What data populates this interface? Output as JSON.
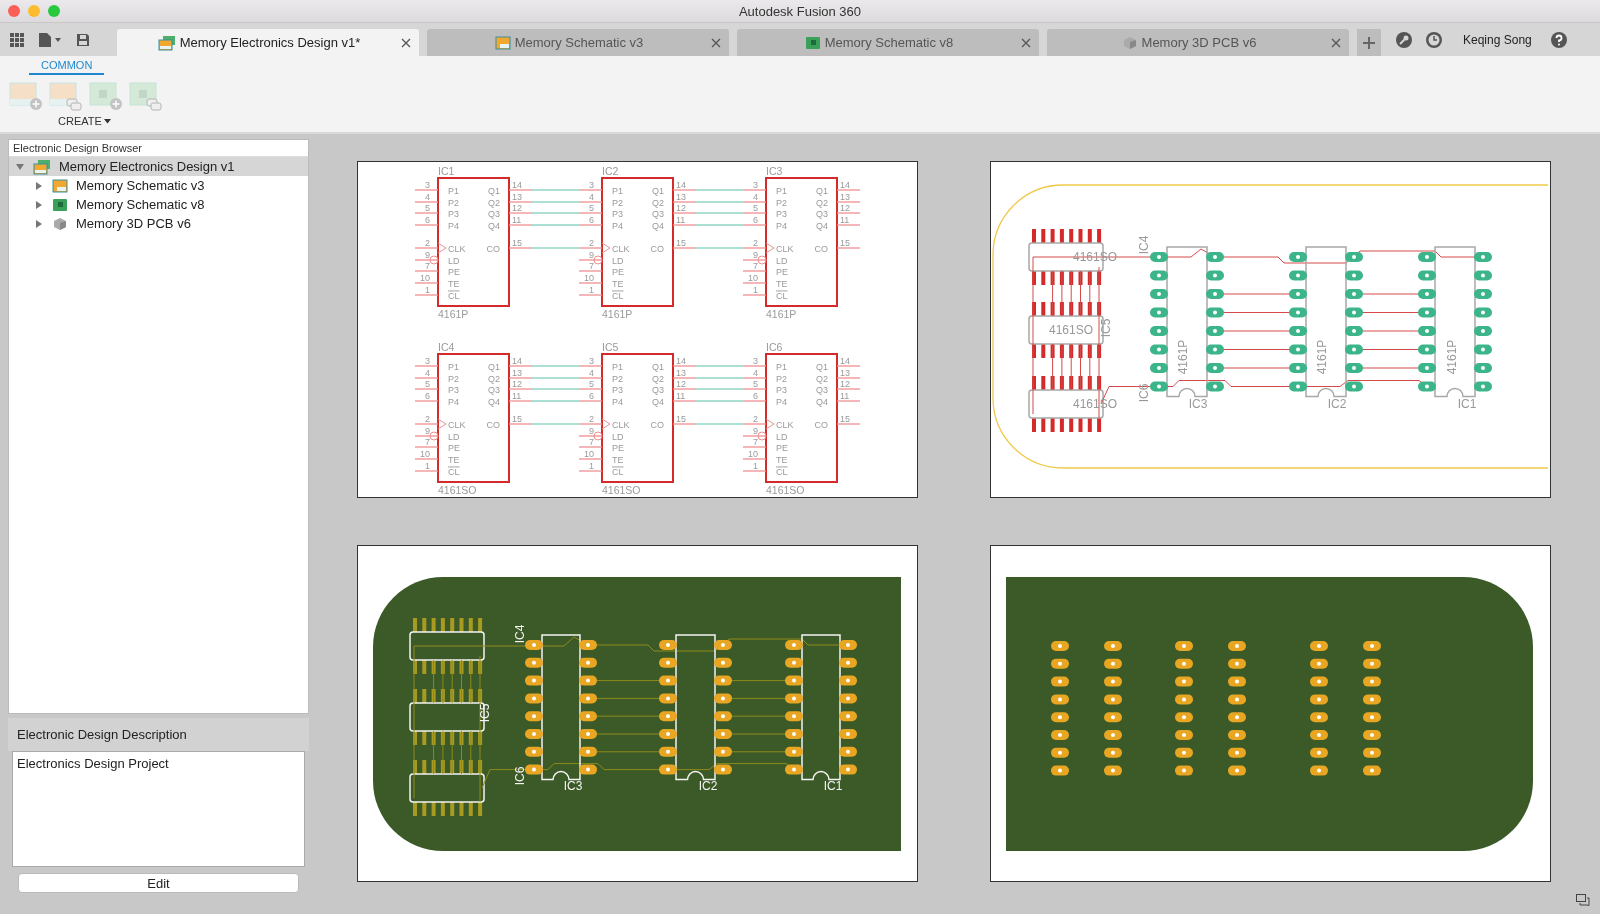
{
  "window": {
    "title": "Autodesk Fusion 360"
  },
  "tabs": [
    {
      "label": "Memory Electronics Design v1*",
      "kind": "design",
      "selected": true
    },
    {
      "label": "Memory Schematic v3",
      "kind": "schematic",
      "selected": false
    },
    {
      "label": "Memory Schematic v8",
      "kind": "board",
      "selected": false
    },
    {
      "label": "Memory 3D PCB v6",
      "kind": "pcb3d",
      "selected": false
    }
  ],
  "user": {
    "name": "Keqing Song"
  },
  "toolbar": {
    "tabs": [
      {
        "label": "COMMON",
        "selected": true
      }
    ],
    "group_label": "CREATE"
  },
  "browser": {
    "title": "Electronic Design Browser",
    "tree": [
      {
        "label": "Memory Electronics Design v1",
        "kind": "design",
        "selected": true,
        "expanded": true,
        "children": [
          {
            "label": "Memory Schematic v3",
            "kind": "schematic",
            "selected": false,
            "expanded": false
          },
          {
            "label": "Memory Schematic v8",
            "kind": "board",
            "selected": false,
            "expanded": false
          },
          {
            "label": "Memory 3D PCB v6",
            "kind": "pcb3d",
            "selected": false,
            "expanded": false
          }
        ]
      }
    ]
  },
  "description": {
    "title": "Electronic Design Description",
    "text": "Electronics Design Project",
    "button": "Edit"
  },
  "viewports": [
    {
      "kind": "schematic",
      "parts": [
        {
          "name": "IC1",
          "package": "4161P",
          "left_pins": [
            {
              "number": "3",
              "label": "P1",
              "kind": "plain"
            },
            {
              "number": "4",
              "label": "P2",
              "kind": "plain"
            },
            {
              "number": "5",
              "label": "P3",
              "kind": "plain"
            },
            {
              "number": "6",
              "label": "P4",
              "kind": "plain"
            },
            {
              "number": "2",
              "label": "CLK",
              "kind": "clock"
            },
            {
              "number": "9",
              "label": "LD",
              "kind": "inverted"
            },
            {
              "number": "7",
              "label": "PE",
              "kind": "plain"
            },
            {
              "number": "10",
              "label": "TE",
              "kind": "plain"
            },
            {
              "number": "1",
              "label": "CL",
              "kind": "active_low"
            }
          ],
          "right_pins": [
            {
              "label": "Q1",
              "number": "14"
            },
            {
              "label": "Q2",
              "number": "13"
            },
            {
              "label": "Q3",
              "number": "12"
            },
            {
              "label": "Q4",
              "number": "11"
            },
            {
              "label": "CO",
              "number": "15"
            }
          ]
        },
        {
          "name": "IC2",
          "package": "4161P",
          "left_pins": [
            {
              "number": "3",
              "label": "P1",
              "kind": "plain"
            },
            {
              "number": "4",
              "label": "P2",
              "kind": "plain"
            },
            {
              "number": "5",
              "label": "P3",
              "kind": "plain"
            },
            {
              "number": "6",
              "label": "P4",
              "kind": "plain"
            },
            {
              "number": "2",
              "label": "CLK",
              "kind": "clock"
            },
            {
              "number": "9",
              "label": "LD",
              "kind": "inverted"
            },
            {
              "number": "7",
              "label": "PE",
              "kind": "plain"
            },
            {
              "number": "10",
              "label": "TE",
              "kind": "plain"
            },
            {
              "number": "1",
              "label": "CL",
              "kind": "active_low"
            }
          ],
          "right_pins": [
            {
              "label": "Q1",
              "number": "14"
            },
            {
              "label": "Q2",
              "number": "13"
            },
            {
              "label": "Q3",
              "number": "12"
            },
            {
              "label": "Q4",
              "number": "11"
            },
            {
              "label": "CO",
              "number": "15"
            }
          ]
        },
        {
          "name": "IC3",
          "package": "4161P",
          "left_pins": [
            {
              "number": "3",
              "label": "P1",
              "kind": "plain"
            },
            {
              "number": "4",
              "label": "P2",
              "kind": "plain"
            },
            {
              "number": "5",
              "label": "P3",
              "kind": "plain"
            },
            {
              "number": "6",
              "label": "P4",
              "kind": "plain"
            },
            {
              "number": "2",
              "label": "CLK",
              "kind": "clock"
            },
            {
              "number": "9",
              "label": "LD",
              "kind": "inverted"
            },
            {
              "number": "7",
              "label": "PE",
              "kind": "plain"
            },
            {
              "number": "10",
              "label": "TE",
              "kind": "plain"
            },
            {
              "number": "1",
              "label": "CL",
              "kind": "active_low"
            }
          ],
          "right_pins": [
            {
              "label": "Q1",
              "number": "14"
            },
            {
              "label": "Q2",
              "number": "13"
            },
            {
              "label": "Q3",
              "number": "12"
            },
            {
              "label": "Q4",
              "number": "11"
            },
            {
              "label": "CO",
              "number": "15"
            }
          ]
        },
        {
          "name": "IC4",
          "package": "4161SO",
          "left_pins": [
            {
              "number": "3",
              "label": "P1",
              "kind": "plain"
            },
            {
              "number": "4",
              "label": "P2",
              "kind": "plain"
            },
            {
              "number": "5",
              "label": "P3",
              "kind": "plain"
            },
            {
              "number": "6",
              "label": "P4",
              "kind": "plain"
            },
            {
              "number": "2",
              "label": "CLK",
              "kind": "clock"
            },
            {
              "number": "9",
              "label": "LD",
              "kind": "inverted"
            },
            {
              "number": "7",
              "label": "PE",
              "kind": "plain"
            },
            {
              "number": "10",
              "label": "TE",
              "kind": "plain"
            },
            {
              "number": "1",
              "label": "CL",
              "kind": "active_low"
            }
          ],
          "right_pins": [
            {
              "label": "Q1",
              "number": "14"
            },
            {
              "label": "Q2",
              "number": "13"
            },
            {
              "label": "Q3",
              "number": "12"
            },
            {
              "label": "Q4",
              "number": "11"
            },
            {
              "label": "CO",
              "number": "15"
            }
          ]
        },
        {
          "name": "IC5",
          "package": "4161SO",
          "left_pins": [
            {
              "number": "3",
              "label": "P1",
              "kind": "plain"
            },
            {
              "number": "4",
              "label": "P2",
              "kind": "plain"
            },
            {
              "number": "5",
              "label": "P3",
              "kind": "plain"
            },
            {
              "number": "6",
              "label": "P4",
              "kind": "plain"
            },
            {
              "number": "2",
              "label": "CLK",
              "kind": "clock"
            },
            {
              "number": "9",
              "label": "LD",
              "kind": "inverted"
            },
            {
              "number": "7",
              "label": "PE",
              "kind": "plain"
            },
            {
              "number": "10",
              "label": "TE",
              "kind": "plain"
            },
            {
              "number": "1",
              "label": "CL",
              "kind": "active_low"
            }
          ],
          "right_pins": [
            {
              "label": "Q1",
              "number": "14"
            },
            {
              "label": "Q2",
              "number": "13"
            },
            {
              "label": "Q3",
              "number": "12"
            },
            {
              "label": "Q4",
              "number": "11"
            },
            {
              "label": "CO",
              "number": "15"
            }
          ]
        },
        {
          "name": "IC6",
          "package": "4161SO",
          "left_pins": [
            {
              "number": "3",
              "label": "P1",
              "kind": "plain"
            },
            {
              "number": "4",
              "label": "P2",
              "kind": "plain"
            },
            {
              "number": "5",
              "label": "P3",
              "kind": "plain"
            },
            {
              "number": "6",
              "label": "P4",
              "kind": "plain"
            },
            {
              "number": "2",
              "label": "CLK",
              "kind": "clock"
            },
            {
              "number": "9",
              "label": "LD",
              "kind": "inverted"
            },
            {
              "number": "7",
              "label": "PE",
              "kind": "plain"
            },
            {
              "number": "10",
              "label": "TE",
              "kind": "plain"
            },
            {
              "number": "1",
              "label": "CL",
              "kind": "active_low"
            }
          ],
          "right_pins": [
            {
              "label": "Q1",
              "number": "14"
            },
            {
              "label": "Q2",
              "number": "13"
            },
            {
              "label": "Q3",
              "number": "12"
            },
            {
              "label": "Q4",
              "number": "11"
            },
            {
              "label": "CO",
              "number": "15"
            }
          ]
        }
      ]
    },
    {
      "kind": "board_layout",
      "smd_parts": [
        {
          "name": "IC4",
          "package": "4161SO"
        },
        {
          "name": "IC5",
          "package": "4161SO"
        },
        {
          "name": "IC6",
          "package": "4161SO"
        }
      ],
      "dip_parts": [
        {
          "name": "IC3",
          "package": "4161P"
        },
        {
          "name": "IC2",
          "package": "4161P"
        },
        {
          "name": "IC1",
          "package": "4161P"
        }
      ]
    },
    {
      "kind": "board_top",
      "smd_parts": [
        {
          "name": "IC4"
        },
        {
          "name": "IC5"
        },
        {
          "name": "IC6"
        }
      ],
      "dip_parts": [
        {
          "name": "IC3"
        },
        {
          "name": "IC2"
        },
        {
          "name": "IC1"
        }
      ]
    },
    {
      "kind": "board_bottom"
    }
  ]
}
